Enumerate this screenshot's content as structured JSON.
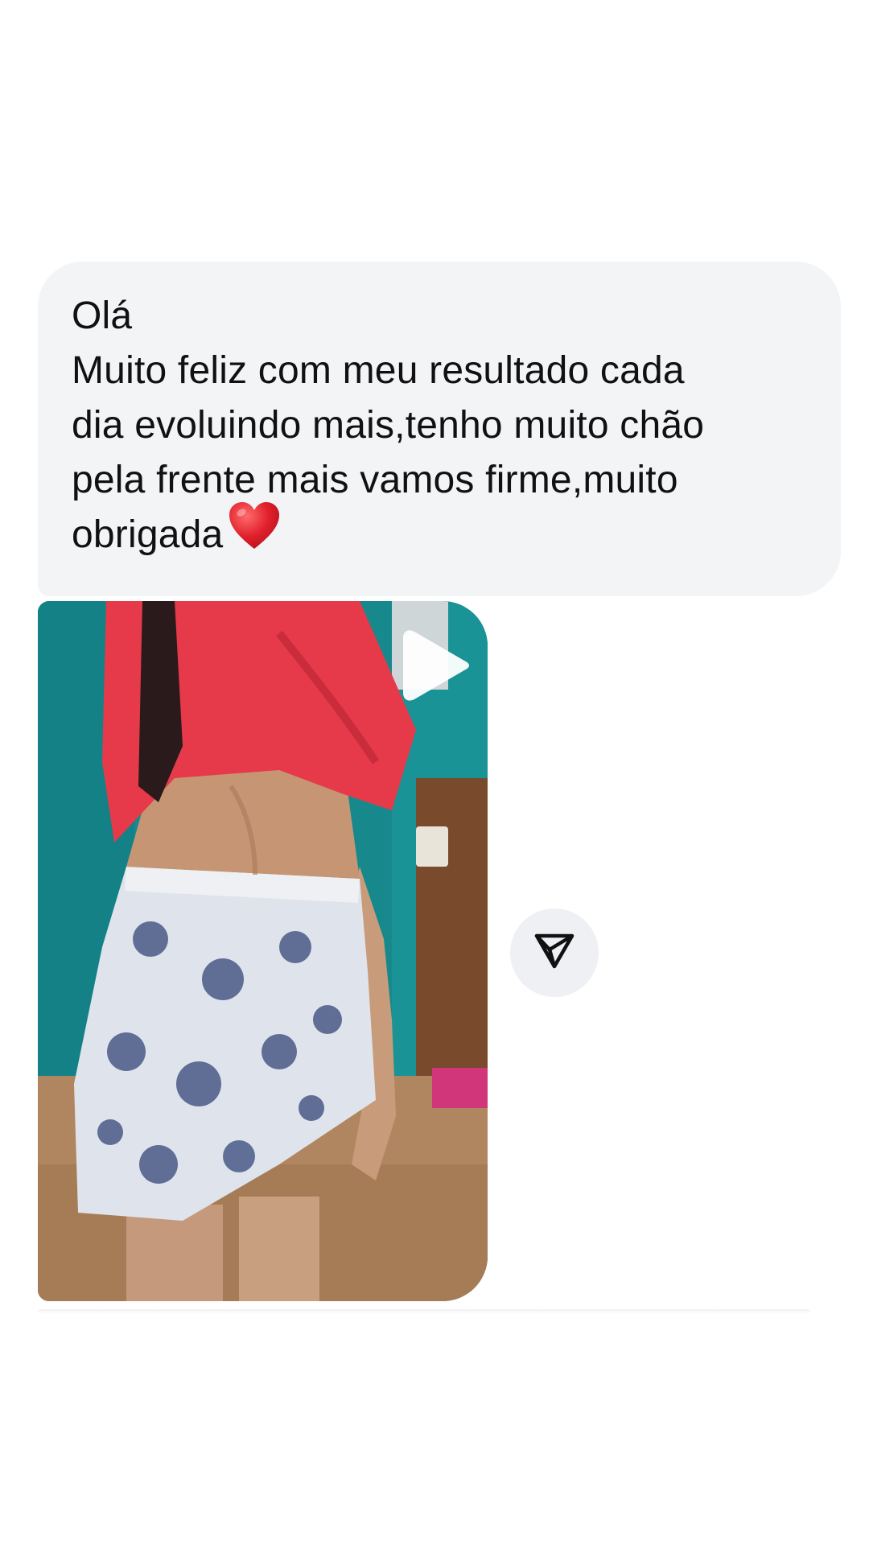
{
  "message": {
    "lines": [
      "Olá",
      "Muito feliz com meu resultado cada",
      "dia evoluindo mais,tenho muito chão",
      "pela frente mais vamos firme,muito",
      "obrigada"
    ],
    "emoji_icon": "red-heart-icon"
  },
  "media": {
    "kind": "video-thumbnail",
    "play_icon": "play-icon"
  },
  "actions": {
    "share_icon": "send-paper-plane-icon"
  },
  "colors": {
    "bubble_background": "#f3f4f6",
    "text": "#111111",
    "share_button_background": "#eff0f3",
    "heart": "#e0202c"
  }
}
